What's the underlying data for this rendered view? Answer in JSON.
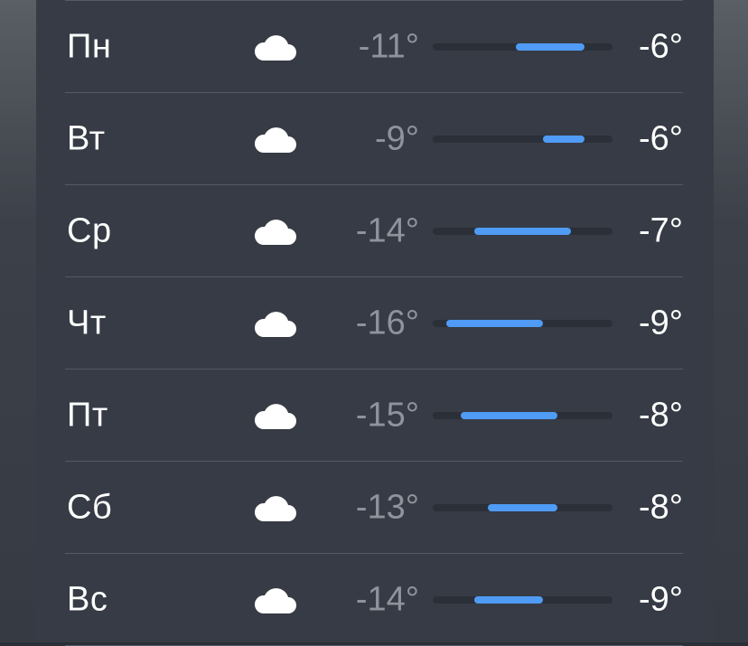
{
  "scale": {
    "min": -17,
    "max": -4
  },
  "days": [
    {
      "day": "Пн",
      "icon": "cloud-icon",
      "low": "-11°",
      "high": "-6°",
      "low_value": -11,
      "high_value": -6
    },
    {
      "day": "Вт",
      "icon": "cloud-icon",
      "low": "-9°",
      "high": "-6°",
      "low_value": -9,
      "high_value": -6
    },
    {
      "day": "Ср",
      "icon": "cloud-icon",
      "low": "-14°",
      "high": "-7°",
      "low_value": -14,
      "high_value": -7
    },
    {
      "day": "Чт",
      "icon": "cloud-icon",
      "low": "-16°",
      "high": "-9°",
      "low_value": -16,
      "high_value": -9
    },
    {
      "day": "Пт",
      "icon": "cloud-icon",
      "low": "-15°",
      "high": "-8°",
      "low_value": -15,
      "high_value": -8
    },
    {
      "day": "Сб",
      "icon": "cloud-icon",
      "low": "-13°",
      "high": "-8°",
      "low_value": -13,
      "high_value": -8
    },
    {
      "day": "Вс",
      "icon": "cloud-icon",
      "low": "-14°",
      "high": "-9°",
      "low_value": -14,
      "high_value": -9
    }
  ],
  "colors": {
    "bar_fill": "#4f9bf5",
    "bar_track": "#2b2f38",
    "low_text": "#8e939c",
    "high_text": "#ffffff"
  }
}
